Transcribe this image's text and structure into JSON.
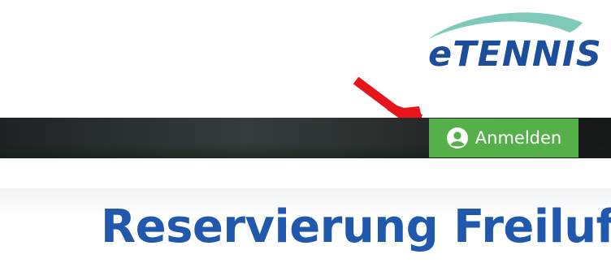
{
  "brand": {
    "logo_text": "eTENNIS",
    "primary_color": "#1c4e9c",
    "swoosh_color": "#7fc9bb"
  },
  "annotation": {
    "icon": "red-arrow-icon",
    "color": "#e8141b"
  },
  "nav": {
    "login_label": "Anmelden",
    "login_icon": "user-circle-icon",
    "login_color": "#55b049"
  },
  "page": {
    "title": "Reservierung Freiluft"
  }
}
